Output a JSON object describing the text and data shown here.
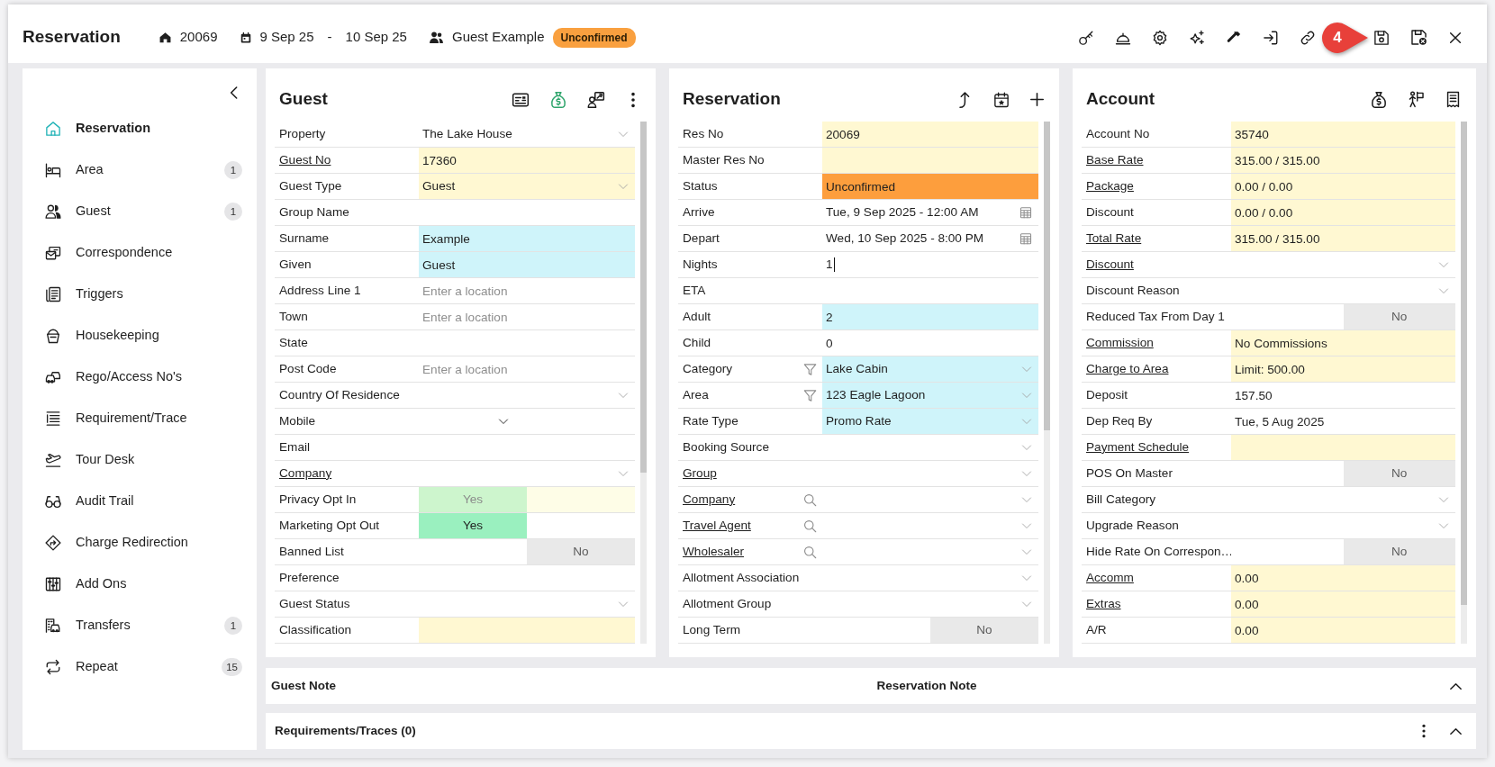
{
  "header": {
    "title": "Reservation",
    "res_no": "20069",
    "arrive": "9 Sep 25",
    "date_separator": "-",
    "depart": "10 Sep 25",
    "guest": "Guest Example",
    "status": "Unconfirmed"
  },
  "step_marker": "4",
  "sidebar": {
    "items": [
      {
        "label": "Reservation",
        "selected": true
      },
      {
        "label": "Area",
        "selected": false,
        "badge": "1"
      },
      {
        "label": "Guest",
        "selected": false,
        "badge": "1"
      },
      {
        "label": "Correspondence",
        "selected": false
      },
      {
        "label": "Triggers",
        "selected": false
      },
      {
        "label": "Housekeeping",
        "selected": false
      },
      {
        "label": "Rego/Access No's",
        "selected": false
      },
      {
        "label": "Requirement/Trace",
        "selected": false
      },
      {
        "label": "Tour Desk",
        "selected": false
      },
      {
        "label": "Audit Trail",
        "selected": false
      },
      {
        "label": "Charge Redirection",
        "selected": false
      },
      {
        "label": "Add Ons",
        "selected": false
      },
      {
        "label": "Transfers",
        "selected": false,
        "badge": "1"
      },
      {
        "label": "Repeat",
        "selected": false,
        "badge": "15"
      }
    ]
  },
  "panels": [
    {
      "title": "Guest",
      "rows": [
        {
          "label": "Property",
          "link": false,
          "kind": "select",
          "value": "The Lake House"
        },
        {
          "label": "Guest No",
          "link": true,
          "kind": "text",
          "value": "17360",
          "color": "#fff8d2"
        },
        {
          "label": "Guest Type",
          "link": false,
          "kind": "select",
          "value": "Guest",
          "color": "#fff8d2"
        },
        {
          "label": "Group Name",
          "link": false,
          "kind": "text"
        },
        {
          "label": "Surname",
          "link": false,
          "kind": "text",
          "value": "Example",
          "color": "#cff4fa"
        },
        {
          "label": "Given",
          "link": false,
          "kind": "text",
          "value": "Guest",
          "color": "#cff4fa"
        },
        {
          "label": "Address Line 1",
          "link": false,
          "kind": "text",
          "placeholder": "Enter a location"
        },
        {
          "label": "Town",
          "link": false,
          "kind": "text",
          "placeholder": "Enter a location"
        },
        {
          "label": "State",
          "link": false,
          "kind": "text"
        },
        {
          "label": "Post Code",
          "link": false,
          "kind": "text",
          "placeholder": "Enter a location"
        },
        {
          "label": "Country Of Residence",
          "link": false,
          "kind": "select"
        },
        {
          "label": "Mobile",
          "link": false,
          "kind": "phone"
        },
        {
          "label": "Email",
          "link": false,
          "kind": "text"
        },
        {
          "label": "Company",
          "link": true,
          "kind": "select"
        },
        {
          "label": "Privacy Opt In",
          "link": false,
          "kind": "toggle",
          "value": "Yes",
          "on": true,
          "disabled": true,
          "color": "#fefde7"
        },
        {
          "label": "Marketing Opt Out",
          "link": false,
          "kind": "toggle",
          "value": "Yes",
          "on": true,
          "disabled": false
        },
        {
          "label": "Banned List",
          "link": false,
          "kind": "toggle",
          "value": "No",
          "on": false,
          "disabled": false
        },
        {
          "label": "Preference",
          "link": false,
          "kind": "text"
        },
        {
          "label": "Guest Status",
          "link": false,
          "kind": "select"
        },
        {
          "label": "Classification",
          "link": false,
          "kind": "text",
          "color": "#fff8d2"
        }
      ]
    },
    {
      "title": "Reservation",
      "rows": [
        {
          "label": "Res No",
          "link": false,
          "kind": "text",
          "value": "20069",
          "color": "#fff8d2"
        },
        {
          "label": "Master Res No",
          "link": false,
          "kind": "text",
          "color": "#fff8d2"
        },
        {
          "label": "Status",
          "link": false,
          "kind": "text",
          "value": "Unconfirmed",
          "color": "#fd9e3d"
        },
        {
          "label": "Arrive",
          "link": false,
          "kind": "date",
          "value": "Tue, 9 Sep 2025 - 12:00 AM"
        },
        {
          "label": "Depart",
          "link": false,
          "kind": "date",
          "value": "Wed, 10 Sep 2025 - 8:00 PM"
        },
        {
          "label": "Nights",
          "link": false,
          "kind": "editing",
          "value": "1"
        },
        {
          "label": "ETA",
          "link": false,
          "kind": "text"
        },
        {
          "label": "Adult",
          "link": false,
          "kind": "text",
          "value": "2",
          "color": "#cff4fa"
        },
        {
          "label": "Child",
          "link": false,
          "kind": "text",
          "value": "0"
        },
        {
          "label": "Category",
          "link": false,
          "kind": "filter-select",
          "value": "Lake Cabin",
          "color": "#cff4fa"
        },
        {
          "label": "Area",
          "link": false,
          "kind": "filter-select",
          "value": "123 Eagle Lagoon",
          "color": "#cff4fa"
        },
        {
          "label": "Rate Type",
          "link": false,
          "kind": "select",
          "value": "Promo Rate",
          "color": "#cff4fa"
        },
        {
          "label": "Booking Source",
          "link": false,
          "kind": "select"
        },
        {
          "label": "Group",
          "link": true,
          "kind": "select"
        },
        {
          "label": "Company",
          "link": true,
          "kind": "lookup"
        },
        {
          "label": "Travel Agent",
          "link": true,
          "kind": "lookup"
        },
        {
          "label": "Wholesaler",
          "link": true,
          "kind": "lookup"
        },
        {
          "label": "Allotment Association",
          "link": false,
          "kind": "select"
        },
        {
          "label": "Allotment Group",
          "link": false,
          "kind": "select"
        },
        {
          "label": "Long Term",
          "link": false,
          "kind": "toggle",
          "value": "No",
          "on": false,
          "disabled": false
        }
      ]
    },
    {
      "title": "Account",
      "rows": [
        {
          "label": "Account No",
          "link": false,
          "kind": "text",
          "value": "35740",
          "color": "#fff8d2"
        },
        {
          "label": "Base Rate",
          "link": true,
          "kind": "text",
          "value": "315.00 / 315.00",
          "color": "#fff8d2"
        },
        {
          "label": "Package",
          "link": true,
          "kind": "text",
          "value": "0.00 / 0.00",
          "color": "#fff8d2"
        },
        {
          "label": "Discount",
          "link": false,
          "kind": "text",
          "value": "0.00 / 0.00",
          "color": "#fff8d2"
        },
        {
          "label": "Total Rate",
          "link": true,
          "kind": "text",
          "value": "315.00 / 315.00",
          "color": "#fff8d2"
        },
        {
          "label": "Discount",
          "link": true,
          "kind": "select"
        },
        {
          "label": "Discount Reason",
          "link": false,
          "kind": "select"
        },
        {
          "label": "Reduced Tax From Day 1",
          "link": false,
          "kind": "toggle",
          "value": "No",
          "on": false,
          "disabled": false
        },
        {
          "label": "Commission",
          "link": true,
          "kind": "text",
          "value": "No Commissions",
          "color": "#fff8d2"
        },
        {
          "label": "Charge to Area",
          "link": true,
          "kind": "text",
          "value": "Limit: 500.00",
          "color": "#fff8d2"
        },
        {
          "label": "Deposit",
          "link": false,
          "kind": "text",
          "value": "157.50"
        },
        {
          "label": "Dep Req By",
          "link": false,
          "kind": "text",
          "value": "Tue, 5 Aug 2025"
        },
        {
          "label": "Payment Schedule",
          "link": true,
          "kind": "text",
          "color": "#fff8d2"
        },
        {
          "label": "POS On Master",
          "link": false,
          "kind": "toggle",
          "value": "No",
          "on": false,
          "disabled": false
        },
        {
          "label": "Bill Category",
          "link": false,
          "kind": "select"
        },
        {
          "label": "Upgrade Reason",
          "link": false,
          "kind": "select"
        },
        {
          "label": "Hide Rate On Correspon…",
          "link": false,
          "kind": "toggle",
          "value": "No",
          "on": false,
          "disabled": false
        },
        {
          "label": "Accomm",
          "link": true,
          "kind": "text",
          "value": "0.00",
          "color": "#fff8d2"
        },
        {
          "label": "Extras",
          "link": true,
          "kind": "text",
          "value": "0.00",
          "color": "#fff8d2"
        },
        {
          "label": "A/R",
          "link": false,
          "kind": "text",
          "value": "0.00",
          "color": "#fff8d2"
        }
      ]
    }
  ],
  "notes_bar": {
    "columns": [
      "Guest Note",
      "Reservation Note"
    ]
  },
  "requirements_bar": {
    "title": "Requirements/Traces (0)"
  }
}
